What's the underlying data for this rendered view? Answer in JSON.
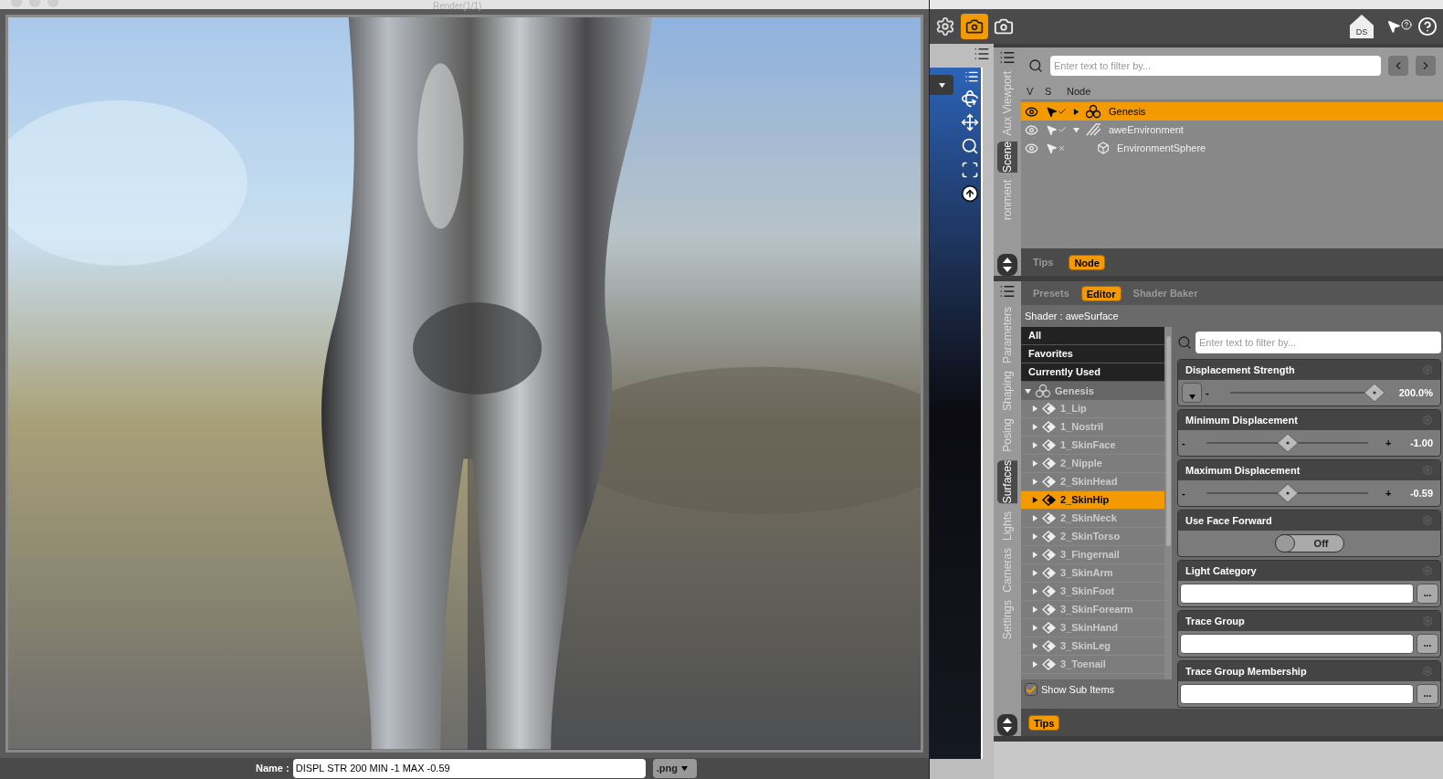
{
  "render_window": {
    "title": "Render(1/1)",
    "name_label": "Name :",
    "name_value": "DISPL STR 200 MIN -1 MAX -0.59",
    "format": ".png"
  },
  "toolbar": {
    "home_label": "DS",
    "render_active": true
  },
  "scene_panel": {
    "side_tabs": [
      {
        "label": "Aux Viewport",
        "selected": false
      },
      {
        "label": "Scene",
        "selected": true
      },
      {
        "label": "ronment",
        "selected": false
      }
    ],
    "filter_placeholder": "Enter text to filter by...",
    "columns": [
      "V",
      "S",
      "Node"
    ],
    "nodes": [
      {
        "label": "Genesis",
        "kind": "figure",
        "selected": true,
        "selectable": true,
        "expanded": false
      },
      {
        "label": "aweEnvironment",
        "kind": "light",
        "selected": false,
        "selectable": true,
        "expanded": true,
        "children": [
          {
            "label": "EnvironmentSphere",
            "kind": "object",
            "selected": false,
            "selectable": false
          }
        ]
      }
    ],
    "bottom_tabs": [
      {
        "label": "Tips",
        "selected": false
      },
      {
        "label": "Node",
        "selected": true
      }
    ]
  },
  "surfaces_panel": {
    "side_tabs": [
      {
        "label": "Parameters",
        "selected": false
      },
      {
        "label": "Shaping",
        "selected": false
      },
      {
        "label": "Posing",
        "selected": false
      },
      {
        "label": "Surfaces",
        "selected": true
      },
      {
        "label": "Lights",
        "selected": false
      },
      {
        "label": "Cameras",
        "selected": false
      },
      {
        "label": "Settings",
        "selected": false
      }
    ],
    "tabs": [
      {
        "label": "Presets",
        "selected": false
      },
      {
        "label": "Editor",
        "selected": true
      },
      {
        "label": "Shader Baker",
        "selected": false
      }
    ],
    "shader_label": "Shader : aweSurface",
    "groups": [
      "All",
      "Favorites",
      "Currently Used"
    ],
    "tree": {
      "label": "Genesis",
      "expanded": true,
      "children": [
        {
          "label": "1_Lip",
          "selected": false
        },
        {
          "label": "1_Nostril",
          "selected": false
        },
        {
          "label": "1_SkinFace",
          "selected": false
        },
        {
          "label": "2_Nipple",
          "selected": false
        },
        {
          "label": "2_SkinHead",
          "selected": false
        },
        {
          "label": "2_SkinHip",
          "selected": true
        },
        {
          "label": "2_SkinNeck",
          "selected": false
        },
        {
          "label": "2_SkinTorso",
          "selected": false
        },
        {
          "label": "3_Fingernail",
          "selected": false
        },
        {
          "label": "3_SkinArm",
          "selected": false
        },
        {
          "label": "3_SkinFoot",
          "selected": false
        },
        {
          "label": "3_SkinForearm",
          "selected": false
        },
        {
          "label": "3_SkinHand",
          "selected": false
        },
        {
          "label": "3_SkinLeg",
          "selected": false
        },
        {
          "label": "3_Toenail",
          "selected": false
        }
      ]
    },
    "show_sub_items": {
      "label": "Show Sub Items",
      "checked": true
    },
    "filter_placeholder": "Enter text to filter by...",
    "properties": [
      {
        "kind": "slider",
        "label": "Displacement Strength",
        "has_menu": true,
        "min_mark": "-",
        "level": 0.97,
        "value": "200.0%"
      },
      {
        "kind": "slider",
        "label": "Minimum Displacement",
        "has_menu": false,
        "min_mark": "-",
        "max_mark": "+",
        "level": 0.5,
        "value": "-1.00"
      },
      {
        "kind": "slider",
        "label": "Maximum Displacement",
        "has_menu": false,
        "min_mark": "-",
        "max_mark": "+",
        "level": 0.5,
        "value": "-0.59"
      },
      {
        "kind": "toggle",
        "label": "Use Face Forward",
        "on": false,
        "value": "Off"
      },
      {
        "kind": "text",
        "label": "Light Category",
        "button": "..."
      },
      {
        "kind": "text",
        "label": "Trace Group",
        "button": "..."
      },
      {
        "kind": "text",
        "label": "Trace Group Membership",
        "button": "..."
      }
    ],
    "bottom_tabs": [
      {
        "label": "Tips",
        "selected": true
      }
    ]
  }
}
